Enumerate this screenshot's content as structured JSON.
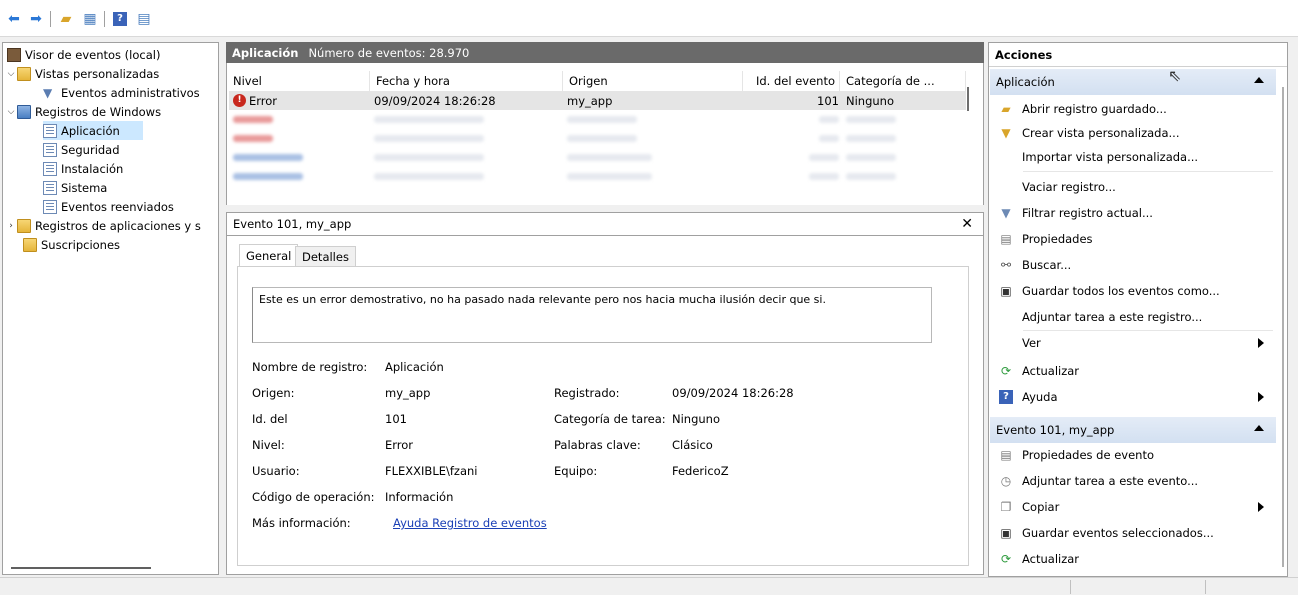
{
  "toolbar": {
    "icons": [
      "back-icon",
      "forward-icon",
      "up-folder-icon",
      "show-hide-tree-icon",
      "help-icon",
      "show-hide-action-icon"
    ]
  },
  "tree": {
    "root": "Visor de eventos (local)",
    "custom_views": "Vistas personalizadas",
    "admin_events": "Eventos administrativos",
    "windows_logs": "Registros de Windows",
    "app": "Aplicación",
    "security": "Seguridad",
    "setup": "Instalación",
    "system": "Sistema",
    "forwarded": "Eventos reenviados",
    "apps_services": "Registros de aplicaciones y s",
    "subscriptions": "Suscripciones"
  },
  "center": {
    "title": "Aplicación",
    "count": "Número de eventos: 28.970",
    "columns": [
      "Nivel",
      "Fecha y hora",
      "Origen",
      "Id. del evento",
      "Categoría de ..."
    ],
    "first_row": {
      "level": "Error",
      "date": "09/09/2024 18:26:28",
      "source": "my_app",
      "id": "101",
      "category": "Ninguno"
    }
  },
  "detail": {
    "header": "Evento 101, my_app",
    "tabs": [
      "General",
      "Detalles"
    ],
    "description": "Este es un error demostrativo, no ha pasado nada relevante pero nos hacia mucha ilusión decir que si.",
    "labels": {
      "log_name": "Nombre de registro:",
      "source": "Origen:",
      "event_id": "Id. del",
      "level": "Nivel:",
      "user": "Usuario:",
      "opcode": "Código de operación:",
      "more_info": "Más información:",
      "logged": "Registrado:",
      "task_category": "Categoría de tarea:",
      "keywords": "Palabras clave:",
      "computer": "Equipo:"
    },
    "values": {
      "log_name": "Aplicación",
      "source": "my_app",
      "event_id": "101",
      "level": "Error",
      "user": "FLEXXIBLE\\fzani",
      "opcode": "Información",
      "more_info": "Ayuda Registro de eventos",
      "logged": "09/09/2024 18:26:28",
      "task_category": "Ninguno",
      "keywords": "Clásico",
      "computer": "FedericoZ"
    }
  },
  "actions": {
    "title": "Acciones",
    "section1": "Aplicación",
    "items1": [
      "Abrir registro guardado...",
      "Crear vista personalizada...",
      "Importar vista personalizada...",
      "Vaciar registro...",
      "Filtrar registro actual...",
      "Propiedades",
      "Buscar...",
      "Guardar todos los eventos como...",
      "Adjuntar tarea a este registro...",
      "Ver",
      "Actualizar",
      "Ayuda"
    ],
    "section2": "Evento 101, my_app",
    "items2": [
      "Propiedades de evento",
      "Adjuntar tarea a este evento...",
      "Copiar",
      "Guardar eventos seleccionados...",
      "Actualizar"
    ]
  }
}
